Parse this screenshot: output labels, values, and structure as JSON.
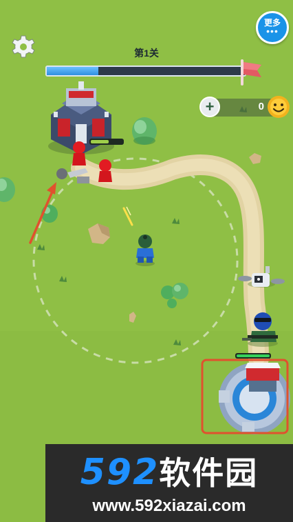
{
  "hud": {
    "level_title": "第1关",
    "progress": 0.26,
    "more_label": "更多",
    "more_dots": "•••",
    "coin_count": "0",
    "coin_add": "+"
  },
  "watermark": {
    "logo_number": "592",
    "logo_text": "软件园",
    "url": "www.592xiazai.com"
  },
  "colors": {
    "grass": "#8fbf45",
    "path": "#e4d4a5",
    "highlight_box": "#e0512e",
    "guide_arrow": "#e0512e",
    "progress_fill": "#2f8fe0",
    "enemy": "#e21b22",
    "player": "#2a6fd6"
  },
  "icons": [
    "gear-icon",
    "flag-icon",
    "plus-icon",
    "smiley-coin-icon"
  ]
}
